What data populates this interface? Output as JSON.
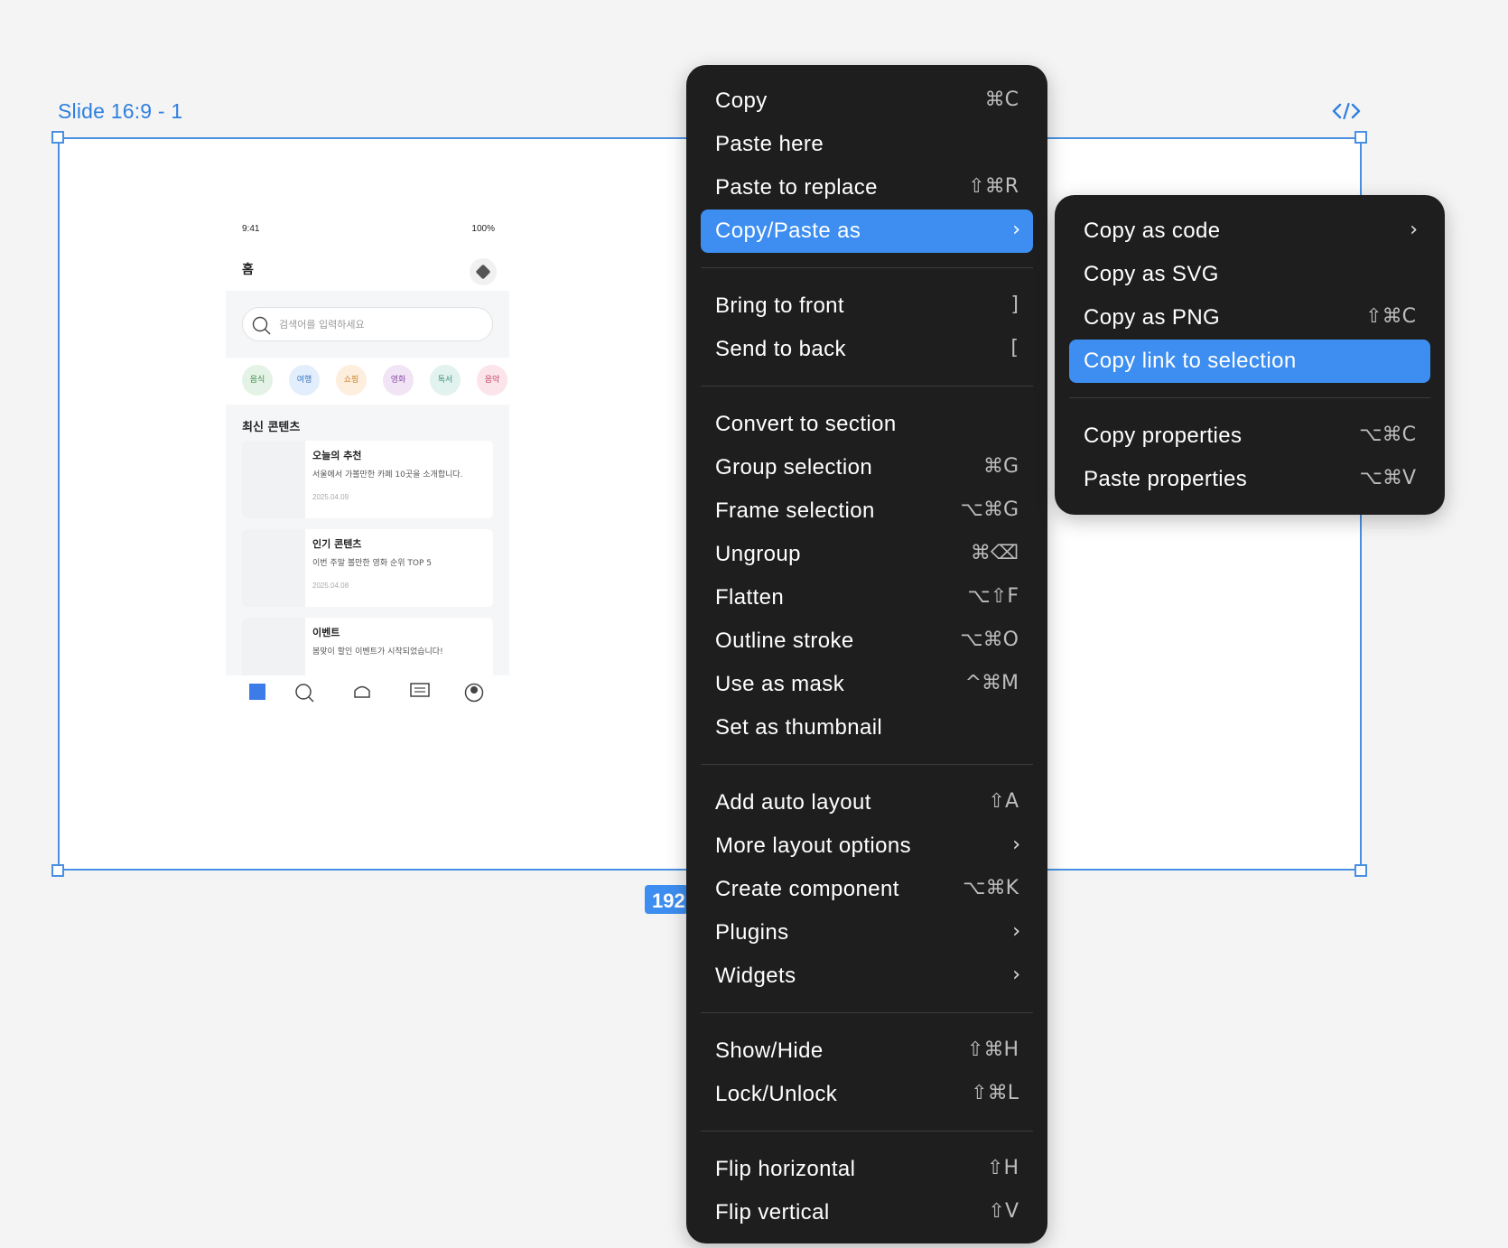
{
  "canvas": {
    "frame_label": "Slide 16:9 - 1",
    "size_badge": "192"
  },
  "phone": {
    "status_time": "9:41",
    "status_battery": "100%",
    "page_title": "홈",
    "search_placeholder": "검색어를 입력하세요",
    "categories": [
      {
        "label": "음식",
        "bg": "#e4f3e6",
        "fg": "#3c8c4a"
      },
      {
        "label": "여행",
        "bg": "#e2eefb",
        "fg": "#3a72c4"
      },
      {
        "label": "쇼핑",
        "bg": "#fdeedd",
        "fg": "#d0822f"
      },
      {
        "label": "영화",
        "bg": "#f1e4f5",
        "fg": "#8a4aa8"
      },
      {
        "label": "독서",
        "bg": "#e2f2ee",
        "fg": "#3f8f7c"
      },
      {
        "label": "음악",
        "bg": "#fbe4ea",
        "fg": "#c5456a"
      }
    ],
    "feed_title": "최신 콘텐츠",
    "cards": [
      {
        "title": "오늘의 추천",
        "desc": "서울에서 가볼만한 카페 10곳을 소개합니다.",
        "date": "2025.04.09"
      },
      {
        "title": "인기 콘텐츠",
        "desc": "이번 주말 볼만한 영화 순위 TOP 5",
        "date": "2025.04.08"
      },
      {
        "title": "이벤트",
        "desc": "봄맞이 할인 이벤트가 시작되었습니다!",
        "date": ""
      }
    ],
    "accent": "#3d7be8"
  },
  "main_menu": {
    "groups": [
      [
        {
          "label": "Copy",
          "shortcut": "⌘C"
        },
        {
          "label": "Paste here",
          "shortcut": ""
        },
        {
          "label": "Paste to replace",
          "shortcut": "⇧⌘R"
        },
        {
          "label": "Copy/Paste as",
          "shortcut": "",
          "submenu": true,
          "active": true
        }
      ],
      [
        {
          "label": "Bring to front",
          "shortcut": "]"
        },
        {
          "label": "Send to back",
          "shortcut": "["
        }
      ],
      [
        {
          "label": "Convert to section",
          "shortcut": ""
        },
        {
          "label": "Group selection",
          "shortcut": "⌘G"
        },
        {
          "label": "Frame selection",
          "shortcut": "⌥⌘G"
        },
        {
          "label": "Ungroup",
          "shortcut": "⌘⌫"
        },
        {
          "label": "Flatten",
          "shortcut": "⌥⇧F"
        },
        {
          "label": "Outline stroke",
          "shortcut": "⌥⌘O"
        },
        {
          "label": "Use as mask",
          "shortcut": "^⌘M"
        },
        {
          "label": "Set as thumbnail",
          "shortcut": ""
        }
      ],
      [
        {
          "label": "Add auto layout",
          "shortcut": "⇧A"
        },
        {
          "label": "More layout options",
          "shortcut": "",
          "submenu": true
        },
        {
          "label": "Create component",
          "shortcut": "⌥⌘K"
        },
        {
          "label": "Plugins",
          "shortcut": "",
          "submenu": true
        },
        {
          "label": "Widgets",
          "shortcut": "",
          "submenu": true
        }
      ],
      [
        {
          "label": "Show/Hide",
          "shortcut": "⇧⌘H"
        },
        {
          "label": "Lock/Unlock",
          "shortcut": "⇧⌘L"
        }
      ],
      [
        {
          "label": "Flip horizontal",
          "shortcut": "⇧H"
        },
        {
          "label": "Flip vertical",
          "shortcut": "⇧V"
        }
      ]
    ]
  },
  "sub_menu": {
    "groups": [
      [
        {
          "label": "Copy as code",
          "shortcut": "",
          "submenu": true
        },
        {
          "label": "Copy as SVG",
          "shortcut": ""
        },
        {
          "label": "Copy as PNG",
          "shortcut": "⇧⌘C"
        },
        {
          "label": "Copy link to selection",
          "shortcut": "",
          "active": true
        }
      ],
      [
        {
          "label": "Copy properties",
          "shortcut": "⌥⌘C"
        },
        {
          "label": "Paste properties",
          "shortcut": "⌥⌘V"
        }
      ]
    ]
  },
  "icons": {
    "submenu_arrow": "›",
    "code": "code-icon",
    "search": "search-icon",
    "settings": "diamond-icon"
  },
  "colors": {
    "selection_blue": "#4a90e2",
    "menu_bg": "#1e1e1e",
    "menu_highlight": "#3d8ef0"
  }
}
